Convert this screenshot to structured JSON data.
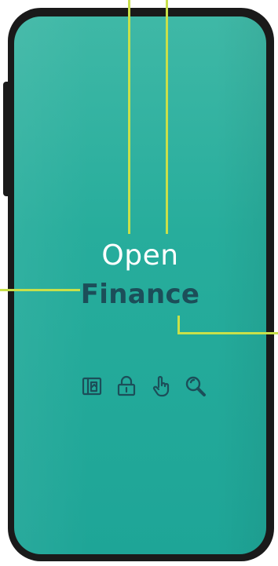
{
  "title": {
    "line1": "Open",
    "line2": "Finance"
  },
  "colors": {
    "screen_top": "#3fb8a6",
    "screen_bottom": "#1ea597",
    "frame": "#1a1a1a",
    "callout": "#c8e04a",
    "title_line1": "#ffffff",
    "title_line2": "#1c4e59",
    "icon": "#1c4e59"
  },
  "icons": [
    "open-book-icon",
    "padlock-icon",
    "pointing-hand-icon",
    "magnifying-glass-icon"
  ]
}
